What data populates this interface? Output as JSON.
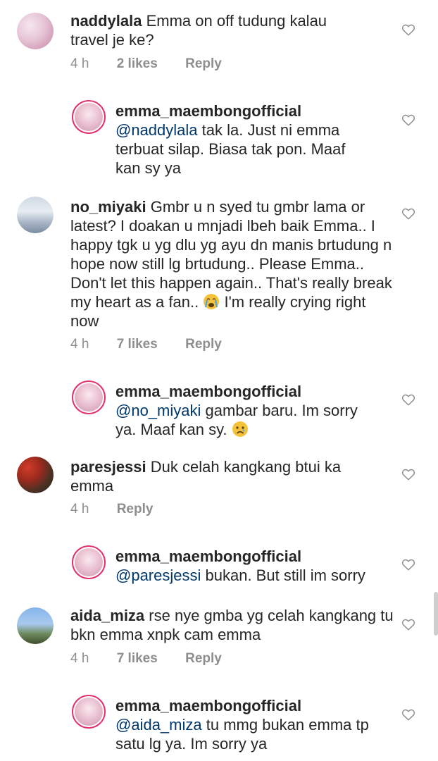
{
  "comments": [
    {
      "username": "naddylala",
      "text": "Emma on off tudung kalau travel je ke?",
      "time": "4 h",
      "likes": "2 likes",
      "reply": "Reply"
    },
    {
      "username": "emma_maembongofficial",
      "mention": "@naddylala",
      "text": "tak la. Just ni emma terbuat silap. Biasa tak pon. Maaf kan sy ya"
    },
    {
      "username": "no_miyaki",
      "text": "Gmbr u n syed tu gmbr lama or latest? I doakan u mnjadi lbeh baik Emma.. I happy tgk u yg dlu yg ayu dn manis brtudung n hope now still lg brtudung.. Please Emma.. Don't let this happen again.. That's really break my heart as a fan..",
      "text_after_emoji": "I'm really crying right now",
      "emoji": "crying-face",
      "time": "4 h",
      "likes": "7 likes",
      "reply": "Reply"
    },
    {
      "username": "emma_maembongofficial",
      "mention": "@no_miyaki",
      "text": "gambar baru. Im sorry ya. Maaf kan sy.",
      "emoji": "sad-face"
    },
    {
      "username": "paresjessi",
      "text": "Duk celah kangkang btui ka emma",
      "time": "4 h",
      "reply": "Reply"
    },
    {
      "username": "emma_maembongofficial",
      "mention": "@paresjessi",
      "text": "bukan. But still im sorry"
    },
    {
      "username": "aida_miza",
      "text": "rse nye gmba yg celah kangkang tu bkn emma xnpk cam emma",
      "time": "4 h",
      "likes": "7 likes",
      "reply": "Reply"
    },
    {
      "username": "emma_maembongofficial",
      "mention": "@aida_miza",
      "text": "tu mmg bukan emma tp satu lg ya. Im sorry ya"
    }
  ],
  "colors": {
    "text": "#262626",
    "meta": "#8e8e8e",
    "mention": "#00376b",
    "story_ring": "#e1306c"
  }
}
